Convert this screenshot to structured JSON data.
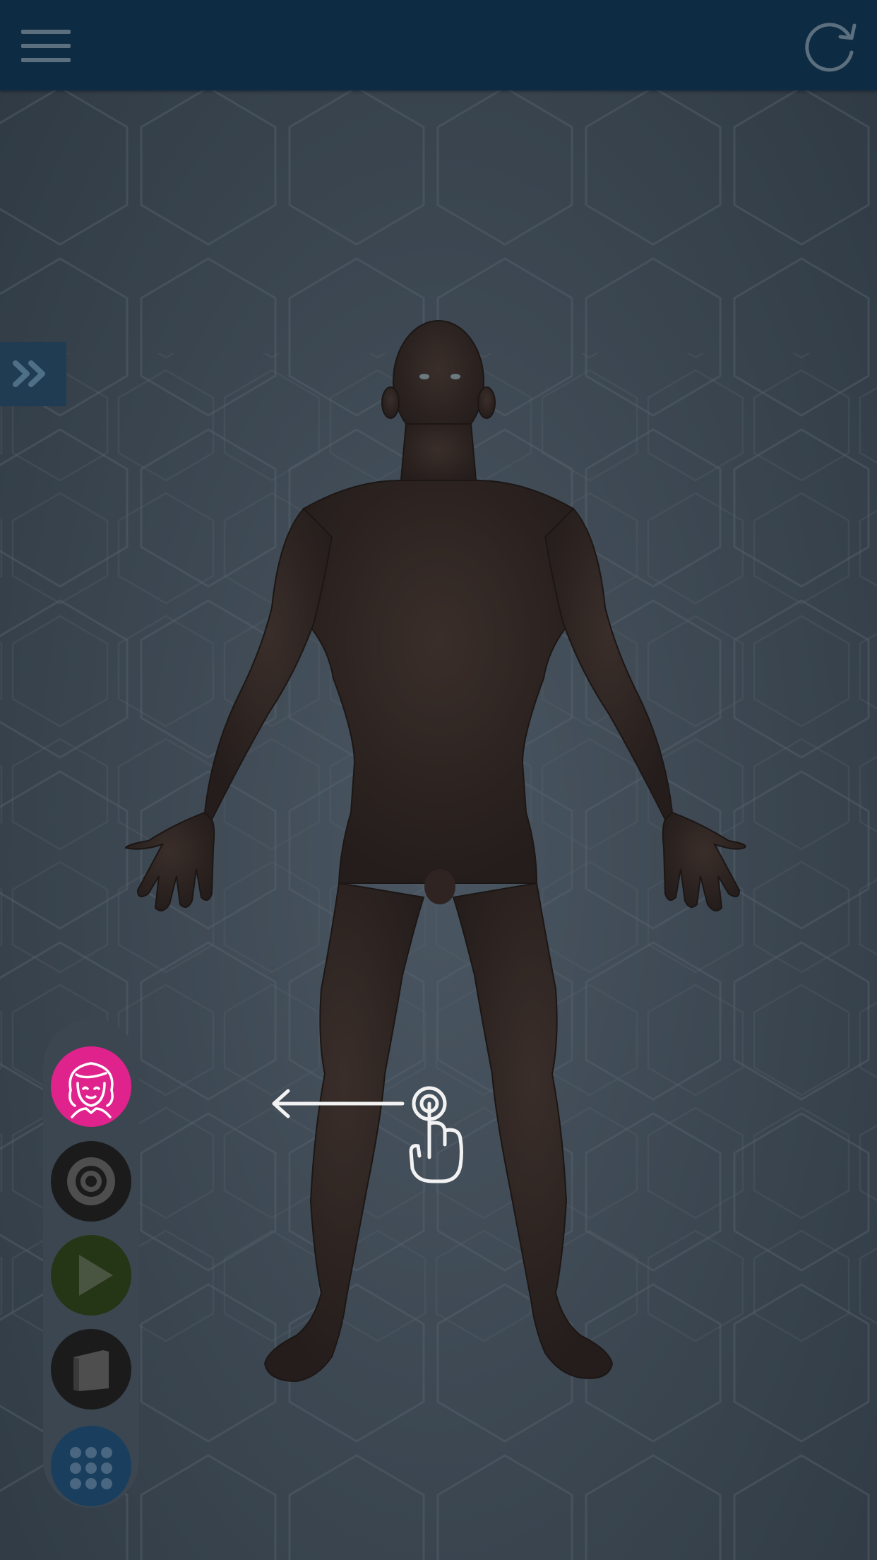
{
  "app": {
    "top_bar": {
      "menu_icon": "hamburger-menu-icon",
      "refresh_icon": "refresh-icon"
    },
    "side_panel_toggle": {
      "icon": "double-chevron-right-icon"
    },
    "model": {
      "subject": "human-male-anatomy-figure"
    },
    "gesture_hint": {
      "icons": [
        "arrow-left-icon",
        "tap-hand-icon"
      ]
    },
    "toolbar": {
      "items": [
        {
          "name": "avatar-button",
          "icon": "female-avatar-icon",
          "color": "#e0228d"
        },
        {
          "name": "target-button",
          "icon": "target-icon",
          "color": "#1b1b1b"
        },
        {
          "name": "play-button",
          "icon": "play-icon",
          "color": "#243616"
        },
        {
          "name": "book-button",
          "icon": "book-icon",
          "color": "#1b1b1b"
        },
        {
          "name": "apps-button",
          "icon": "grid-dots-icon",
          "color": "#1a3f5e"
        }
      ]
    }
  },
  "colors": {
    "top_bar": "#0d2b42",
    "background": "#3d4853",
    "accent_pink": "#e0228d"
  }
}
